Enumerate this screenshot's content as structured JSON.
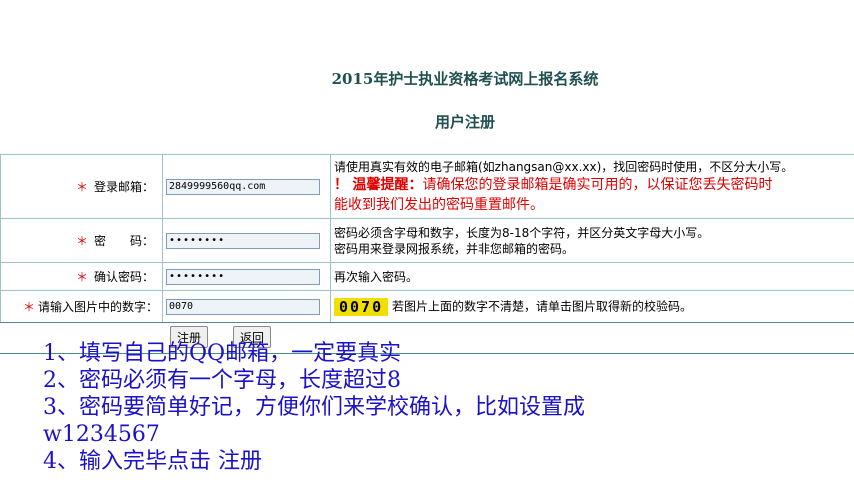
{
  "header": {
    "site_title": "2015年护士执业资格考试网上报名系统",
    "page_title": "用户注册"
  },
  "form": {
    "email": {
      "required_mark": "＊",
      "label": "登录邮箱：",
      "value": "2849999560qq.com",
      "help": "请使用真实有效的电子邮箱(如zhangsan@xx.xx)，找回密码时使用，不区分大小写。",
      "warning_mark": "！",
      "warning_title": "温馨提醒：",
      "warning_text": "请确保您的登录邮箱是确实可用的，以保证您丢失密码时",
      "warning_text2": "能收到我们发出的密码重置邮件。"
    },
    "password": {
      "required_mark": "＊",
      "label": "密　　码：",
      "value": "••••••••",
      "help1": "密码必须含字母和数字，长度为8-18个字符，并区分英文字母大小写。",
      "help2": "密码用来登录网报系统，并非您邮箱的密码。"
    },
    "confirm": {
      "required_mark": "＊",
      "label": "确认密码：",
      "value": "••••••••",
      "help": "再次输入密码。"
    },
    "captcha": {
      "required_mark": "＊",
      "label": "请输入图片中的数字：",
      "value": "0070",
      "image_text": "0070",
      "help": "若图片上面的数字不清楚，请单击图片取得新的校验码。"
    },
    "buttons": {
      "register": "注册",
      "back": "返回"
    }
  },
  "notes": [
    "1、填写自己的QQ邮箱，一定要真实",
    "2、密码必须有一个字母，长度超过8",
    "3、密码要简单好记，方便你们来学校确认，比如设置成",
    "w1234567",
    "4、输入完毕点击 注册"
  ]
}
